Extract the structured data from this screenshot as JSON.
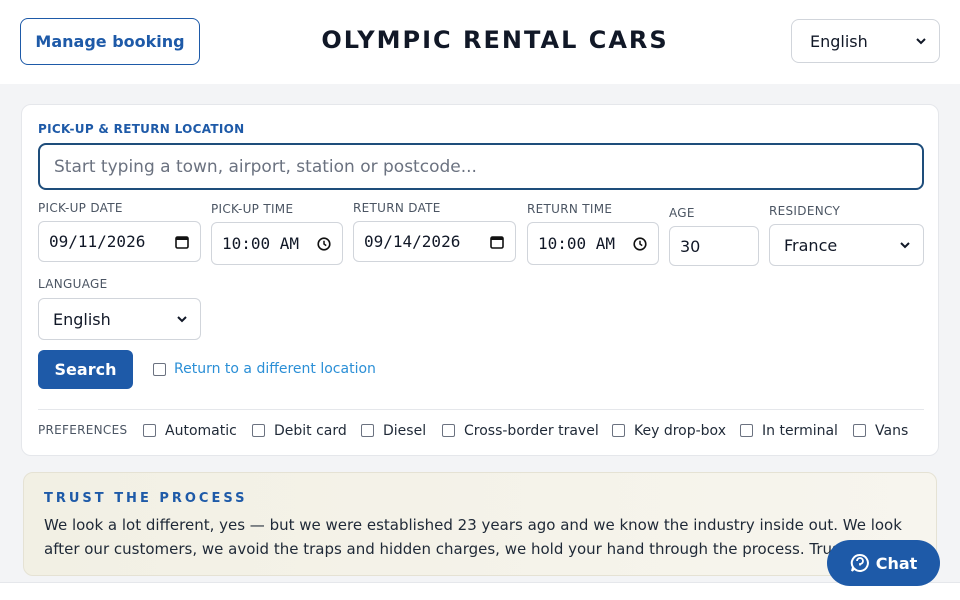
{
  "header": {
    "manage_label": "Manage booking",
    "brand": "OLYMPIC RENTAL CARS",
    "language": "English"
  },
  "form": {
    "location_label": "PICK-UP & RETURN LOCATION",
    "location_placeholder": "Start typing a town, airport, station or postcode...",
    "pickup_date_label": "PICK-UP DATE",
    "pickup_date": "09/11/2026",
    "pickup_time_label": "PICK-UP TIME",
    "pickup_time": "10:00 AM",
    "return_date_label": "RETURN DATE",
    "return_date": "09/14/2026",
    "return_time_label": "RETURN TIME",
    "return_time": "10:00 AM",
    "age_label": "AGE",
    "age": "30",
    "residency_label": "RESIDENCY",
    "residency": "France",
    "language_label": "LANGUAGE",
    "language": "English",
    "search_label": "Search",
    "different_location_label": "Return to a different location"
  },
  "preferences": {
    "label": "PREFERENCES",
    "items": [
      "Automatic",
      "Debit card",
      "Diesel",
      "Cross-border travel",
      "Key drop-box",
      "In terminal",
      "Vans"
    ]
  },
  "trust": {
    "title": "TRUST THE PROCESS",
    "body": "We look a lot different, yes — but we were established 23 years ago and we know the industry inside out. We look after our customers, we avoid the traps and hidden charges, we hold your hand through the process. Trust"
  },
  "chat": {
    "label": "Chat"
  },
  "icons": {
    "calendar": "calendar-icon",
    "clock": "clock-icon",
    "chevron": "chevron-down-icon",
    "chat": "chat-bubble-icon"
  },
  "colors": {
    "accent": "#1e5aa8",
    "link": "#2b8fd6"
  }
}
